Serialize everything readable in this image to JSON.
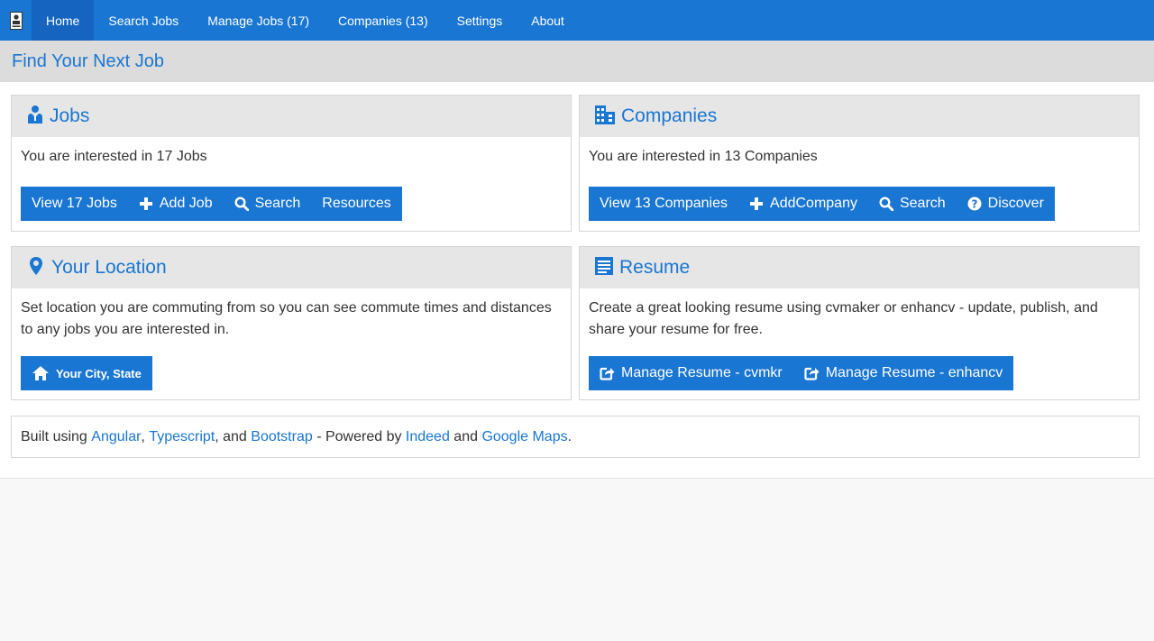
{
  "nav": {
    "items": [
      {
        "label": "Home"
      },
      {
        "label": "Search Jobs"
      },
      {
        "label": "Manage Jobs (17)"
      },
      {
        "label": "Companies (13)"
      },
      {
        "label": "Settings"
      },
      {
        "label": "About"
      }
    ]
  },
  "page": {
    "title": "Find Your Next Job"
  },
  "jobs": {
    "title": "Jobs",
    "text": "You are interested in 17 Jobs",
    "buttons": [
      "View 17 Jobs",
      "Add Job",
      "Search",
      "Resources"
    ]
  },
  "companies": {
    "title": "Companies",
    "text": "You are interested in 13 Companies",
    "buttons": [
      "View 13 Companies",
      "AddCompany",
      "Search",
      "Discover"
    ]
  },
  "location": {
    "title": "Your Location",
    "text": "Set location you are commuting from so you can see commute times and distances to any jobs you are interested in.",
    "button": "Your City, State"
  },
  "resume": {
    "title": "Resume",
    "text": "Create a great looking resume using cvmaker or enhancv - update, publish, and share your resume for free.",
    "buttons": [
      "Manage Resume - cvmkr",
      "Manage Resume - enhancv"
    ]
  },
  "footer": {
    "prefix": "Built using ",
    "angular": "Angular",
    "sep1": ", ",
    "typescript": "Typescript",
    "sep2": ", and ",
    "bootstrap": "Bootstrap",
    "powered": " - Powered by ",
    "indeed": "Indeed",
    "and": " and ",
    "maps": "Google Maps",
    "end": "."
  },
  "colors": {
    "primary": "#1976d2",
    "header_bg": "#dcdcdc",
    "card_head_bg": "#e6e6e6"
  }
}
